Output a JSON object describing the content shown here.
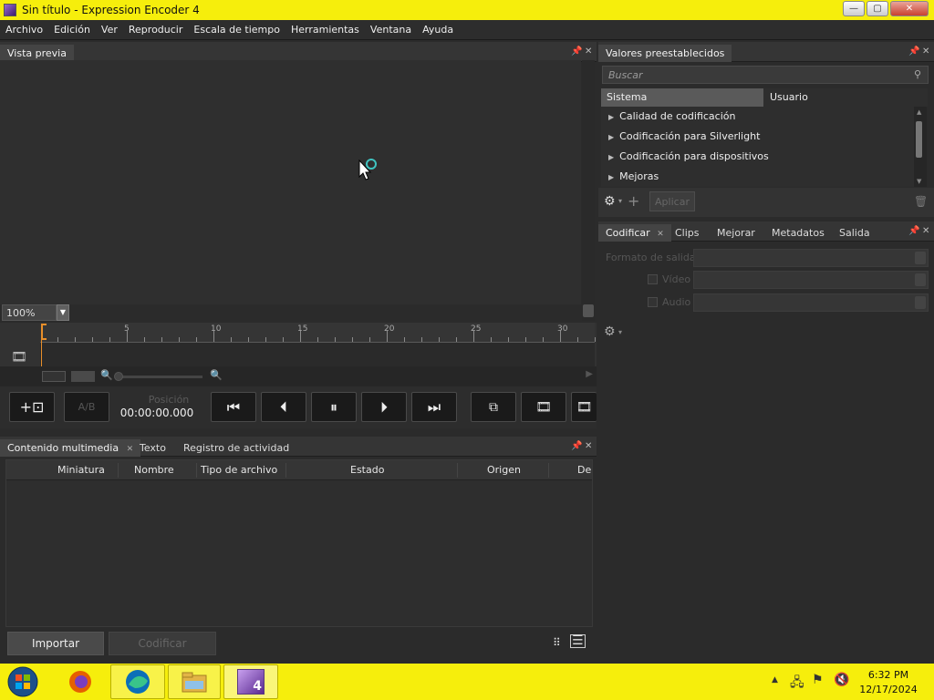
{
  "window": {
    "title": "Sin título - Expression Encoder 4",
    "controls": {
      "minimize": "—",
      "maximize": "▢",
      "close": "✕"
    }
  },
  "menubar": {
    "items": [
      "Archivo",
      "Edición",
      "Ver",
      "Reproducir",
      "Escala de tiempo",
      "Herramientas",
      "Ventana",
      "Ayuda"
    ]
  },
  "preview": {
    "tab": "Vista previa",
    "zoom": "100%"
  },
  "timeline": {
    "ruler_labels": [
      "5",
      "10",
      "15",
      "20",
      "25",
      "30"
    ]
  },
  "transport": {
    "ab_label": "A/B",
    "position_label": "Posición",
    "position_value": "00:00:00.000"
  },
  "presets": {
    "tab": "Valores preestablecidos",
    "search_placeholder": "Buscar",
    "segments": [
      "Sistema",
      "Usuario"
    ],
    "items": [
      "Calidad de codificación",
      "Codificación para Silverlight",
      "Codificación para dispositivos",
      "Mejoras"
    ],
    "apply_label": "Aplicar"
  },
  "encode_panel": {
    "tabs": [
      "Codificar",
      "Clips",
      "Mejorar",
      "Metadatos",
      "Salida"
    ],
    "output_format_label": "Formato de salida",
    "video_label": "Vídeo",
    "audio_label": "Audio"
  },
  "media_panel": {
    "tabs": [
      "Contenido multimedia",
      "Texto",
      "Registro de actividad"
    ],
    "columns": [
      "Miniatura",
      "Nombre",
      "Tipo de archivo",
      "Estado",
      "Origen",
      "De"
    ],
    "import_label": "Importar",
    "encode_label": "Codificar"
  },
  "taskbar": {
    "clock_time": "6:32 PM",
    "clock_date": "12/17/2024",
    "active_app_badge": "4"
  },
  "icons": [
    "start-orb-icon",
    "firefox-icon",
    "edge-icon",
    "file-explorer-icon",
    "expression-encoder-icon",
    "gear-icon",
    "plus-icon",
    "trash-icon",
    "pin-icon",
    "close-icon",
    "search-icon",
    "film-icon",
    "loading-spinner-icon",
    "mouse-cursor-icon"
  ]
}
